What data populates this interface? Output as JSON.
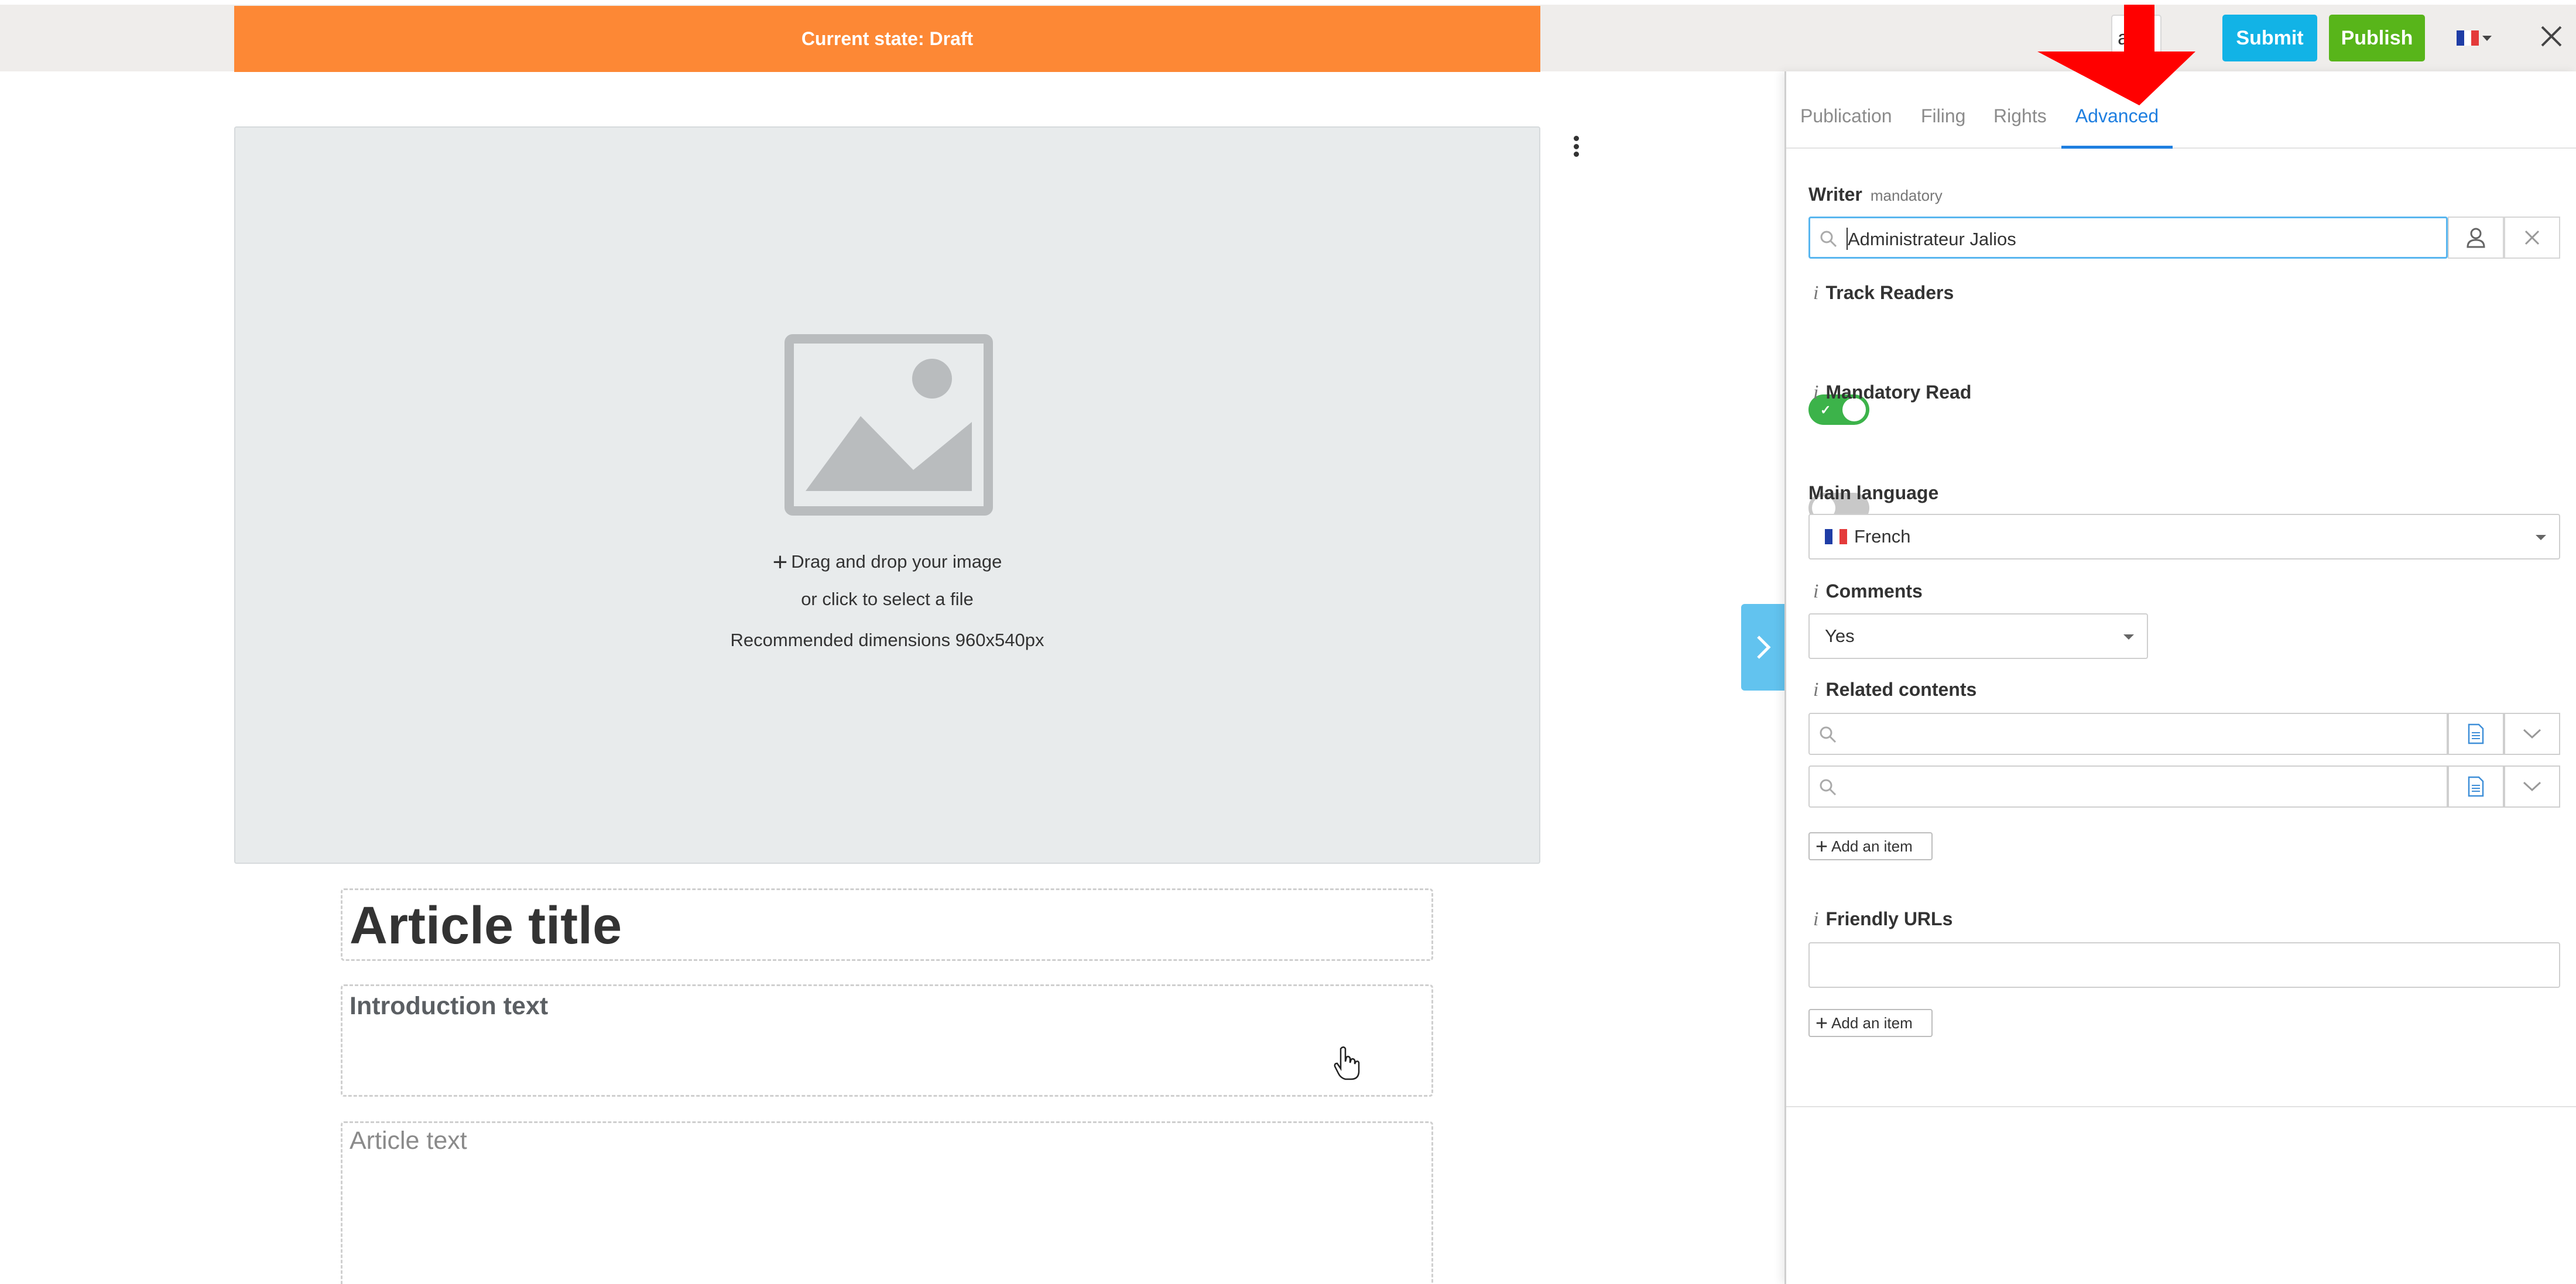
{
  "header": {
    "state_text": "Current state: Draft",
    "save_label": "Save",
    "save_visible_text": "ave",
    "submit_label": "Submit",
    "publish_label": "Publish",
    "language_icon": "french-flag-icon"
  },
  "editor": {
    "image_drop": {
      "line1": "Drag and drop your image",
      "line2": "or click to select a file",
      "line3": "Recommended dimensions 960x540px"
    },
    "title_placeholder": "Article title",
    "intro_placeholder": "Introduction text",
    "text_placeholder": "Article text"
  },
  "panel": {
    "tabs": [
      {
        "label": "Publication",
        "active": false
      },
      {
        "label": "Filing",
        "active": false
      },
      {
        "label": "Rights",
        "active": false
      },
      {
        "label": "Advanced",
        "active": true
      }
    ],
    "writer": {
      "label": "Writer",
      "hint": "mandatory",
      "value": "Administrateur Jalios"
    },
    "track_readers": {
      "label": "Track Readers",
      "enabled": true
    },
    "mandatory_read": {
      "label": "Mandatory Read",
      "enabled": false
    },
    "main_language": {
      "label": "Main language",
      "value": "French"
    },
    "comments": {
      "label": "Comments",
      "value": "Yes"
    },
    "related_contents": {
      "label": "Related contents",
      "rows": 2
    },
    "friendly_urls": {
      "label": "Friendly URLs"
    },
    "add_item_label": "Add an item",
    "info_marker": "i"
  },
  "colors": {
    "state_banner": "#fd8835",
    "submit": "#12b3e6",
    "publish": "#58b51a",
    "active_tab": "#1f7fe0",
    "toggle_on": "#3cb34a",
    "side_tab": "#62c3ef",
    "annotation_arrow": "#ff0000"
  }
}
